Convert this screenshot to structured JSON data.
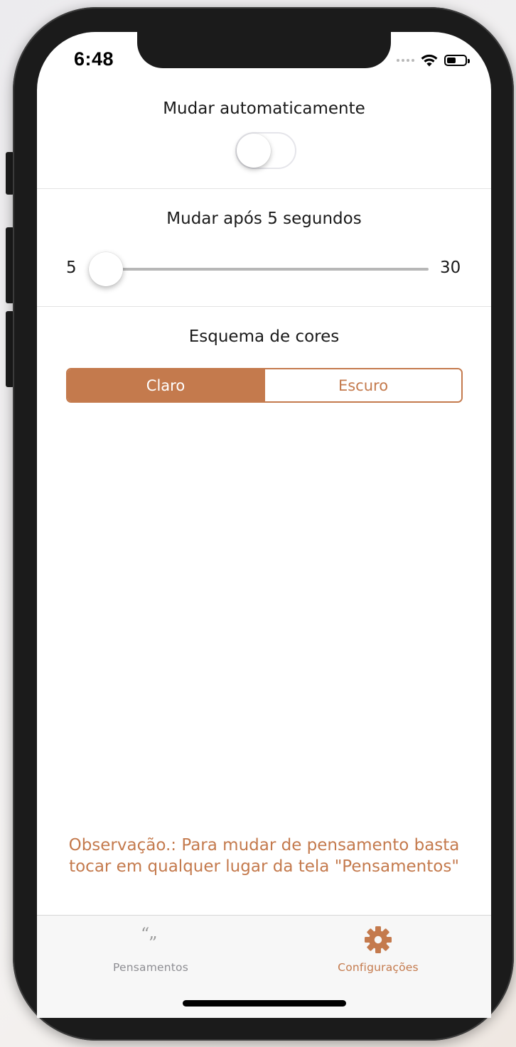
{
  "status_bar": {
    "time": "6:48",
    "wifi_icon": "wifi-icon",
    "battery_icon": "battery-icon"
  },
  "settings": {
    "auto_change": {
      "label": "Mudar automaticamente",
      "enabled": false
    },
    "interval": {
      "label": "Mudar após 5 segundos",
      "min_label": "5",
      "max_label": "30",
      "min": 5,
      "max": 30,
      "value": 5
    },
    "color_scheme": {
      "label": "Esquema de cores",
      "options": [
        "Claro",
        "Escuro"
      ],
      "selected": "Claro"
    }
  },
  "note": {
    "line1": "Observação.: Para mudar de pensamento basta",
    "line2": "tocar em qualquer lugar da tela \"Pensamentos\""
  },
  "tab_bar": {
    "tabs": [
      {
        "label": "Pensamentos",
        "icon": "quote-icon",
        "active": false
      },
      {
        "label": "Configurações",
        "icon": "gear-icon",
        "active": true
      }
    ]
  },
  "colors": {
    "accent": "#c47a4d",
    "inactive": "#8e8e93",
    "track": "#b7b7b7"
  }
}
